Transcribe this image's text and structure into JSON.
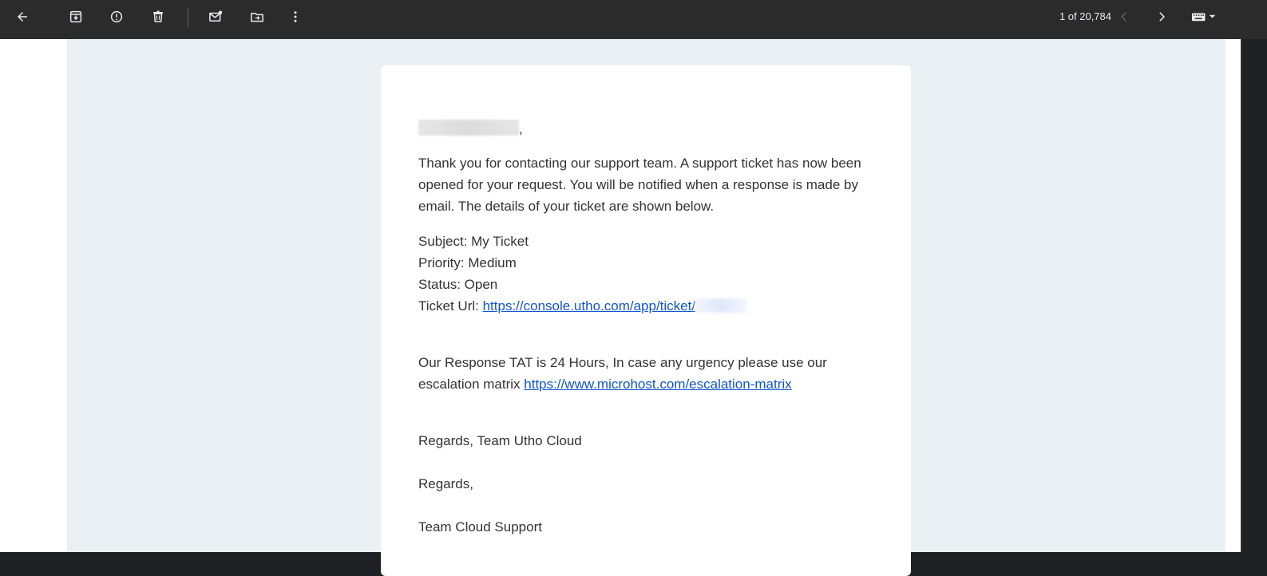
{
  "toolbar": {
    "icons": [
      "back-arrow-icon",
      "archive-icon",
      "report-spam-icon",
      "delete-icon",
      "mark-unread-icon",
      "move-to-icon",
      "more-vert-icon",
      "prev-chevron-icon",
      "next-chevron-icon",
      "keyboard-icon"
    ],
    "count": "1 of 20,784"
  },
  "email": {
    "greeting_suffix": ",",
    "intro": "Thank you for contacting our support team. A support ticket has now been opened for your request. You will be notified when a response is made by email. The details of your ticket are shown below.",
    "subject": "Subject: My Ticket",
    "priority": "Priority: Medium",
    "status": "Status: Open",
    "ticket_label": "Ticket Url: ",
    "ticket_link": "https://console.utho.com/app/ticket/",
    "tat_text": "Our Response TAT is 24 Hours, In case any urgency please use our escalation matrix ",
    "escalation_link": "https://www.microhost.com/escalation-matrix",
    "regards_team": "Regards, Team Utho Cloud",
    "regards": "Regards,",
    "team": "Team Cloud Support"
  },
  "colors": {
    "toolbar_bg": "#2b2b2b",
    "page_bg": "#ebf0f5",
    "link": "#1155cc",
    "text": "#333333"
  }
}
